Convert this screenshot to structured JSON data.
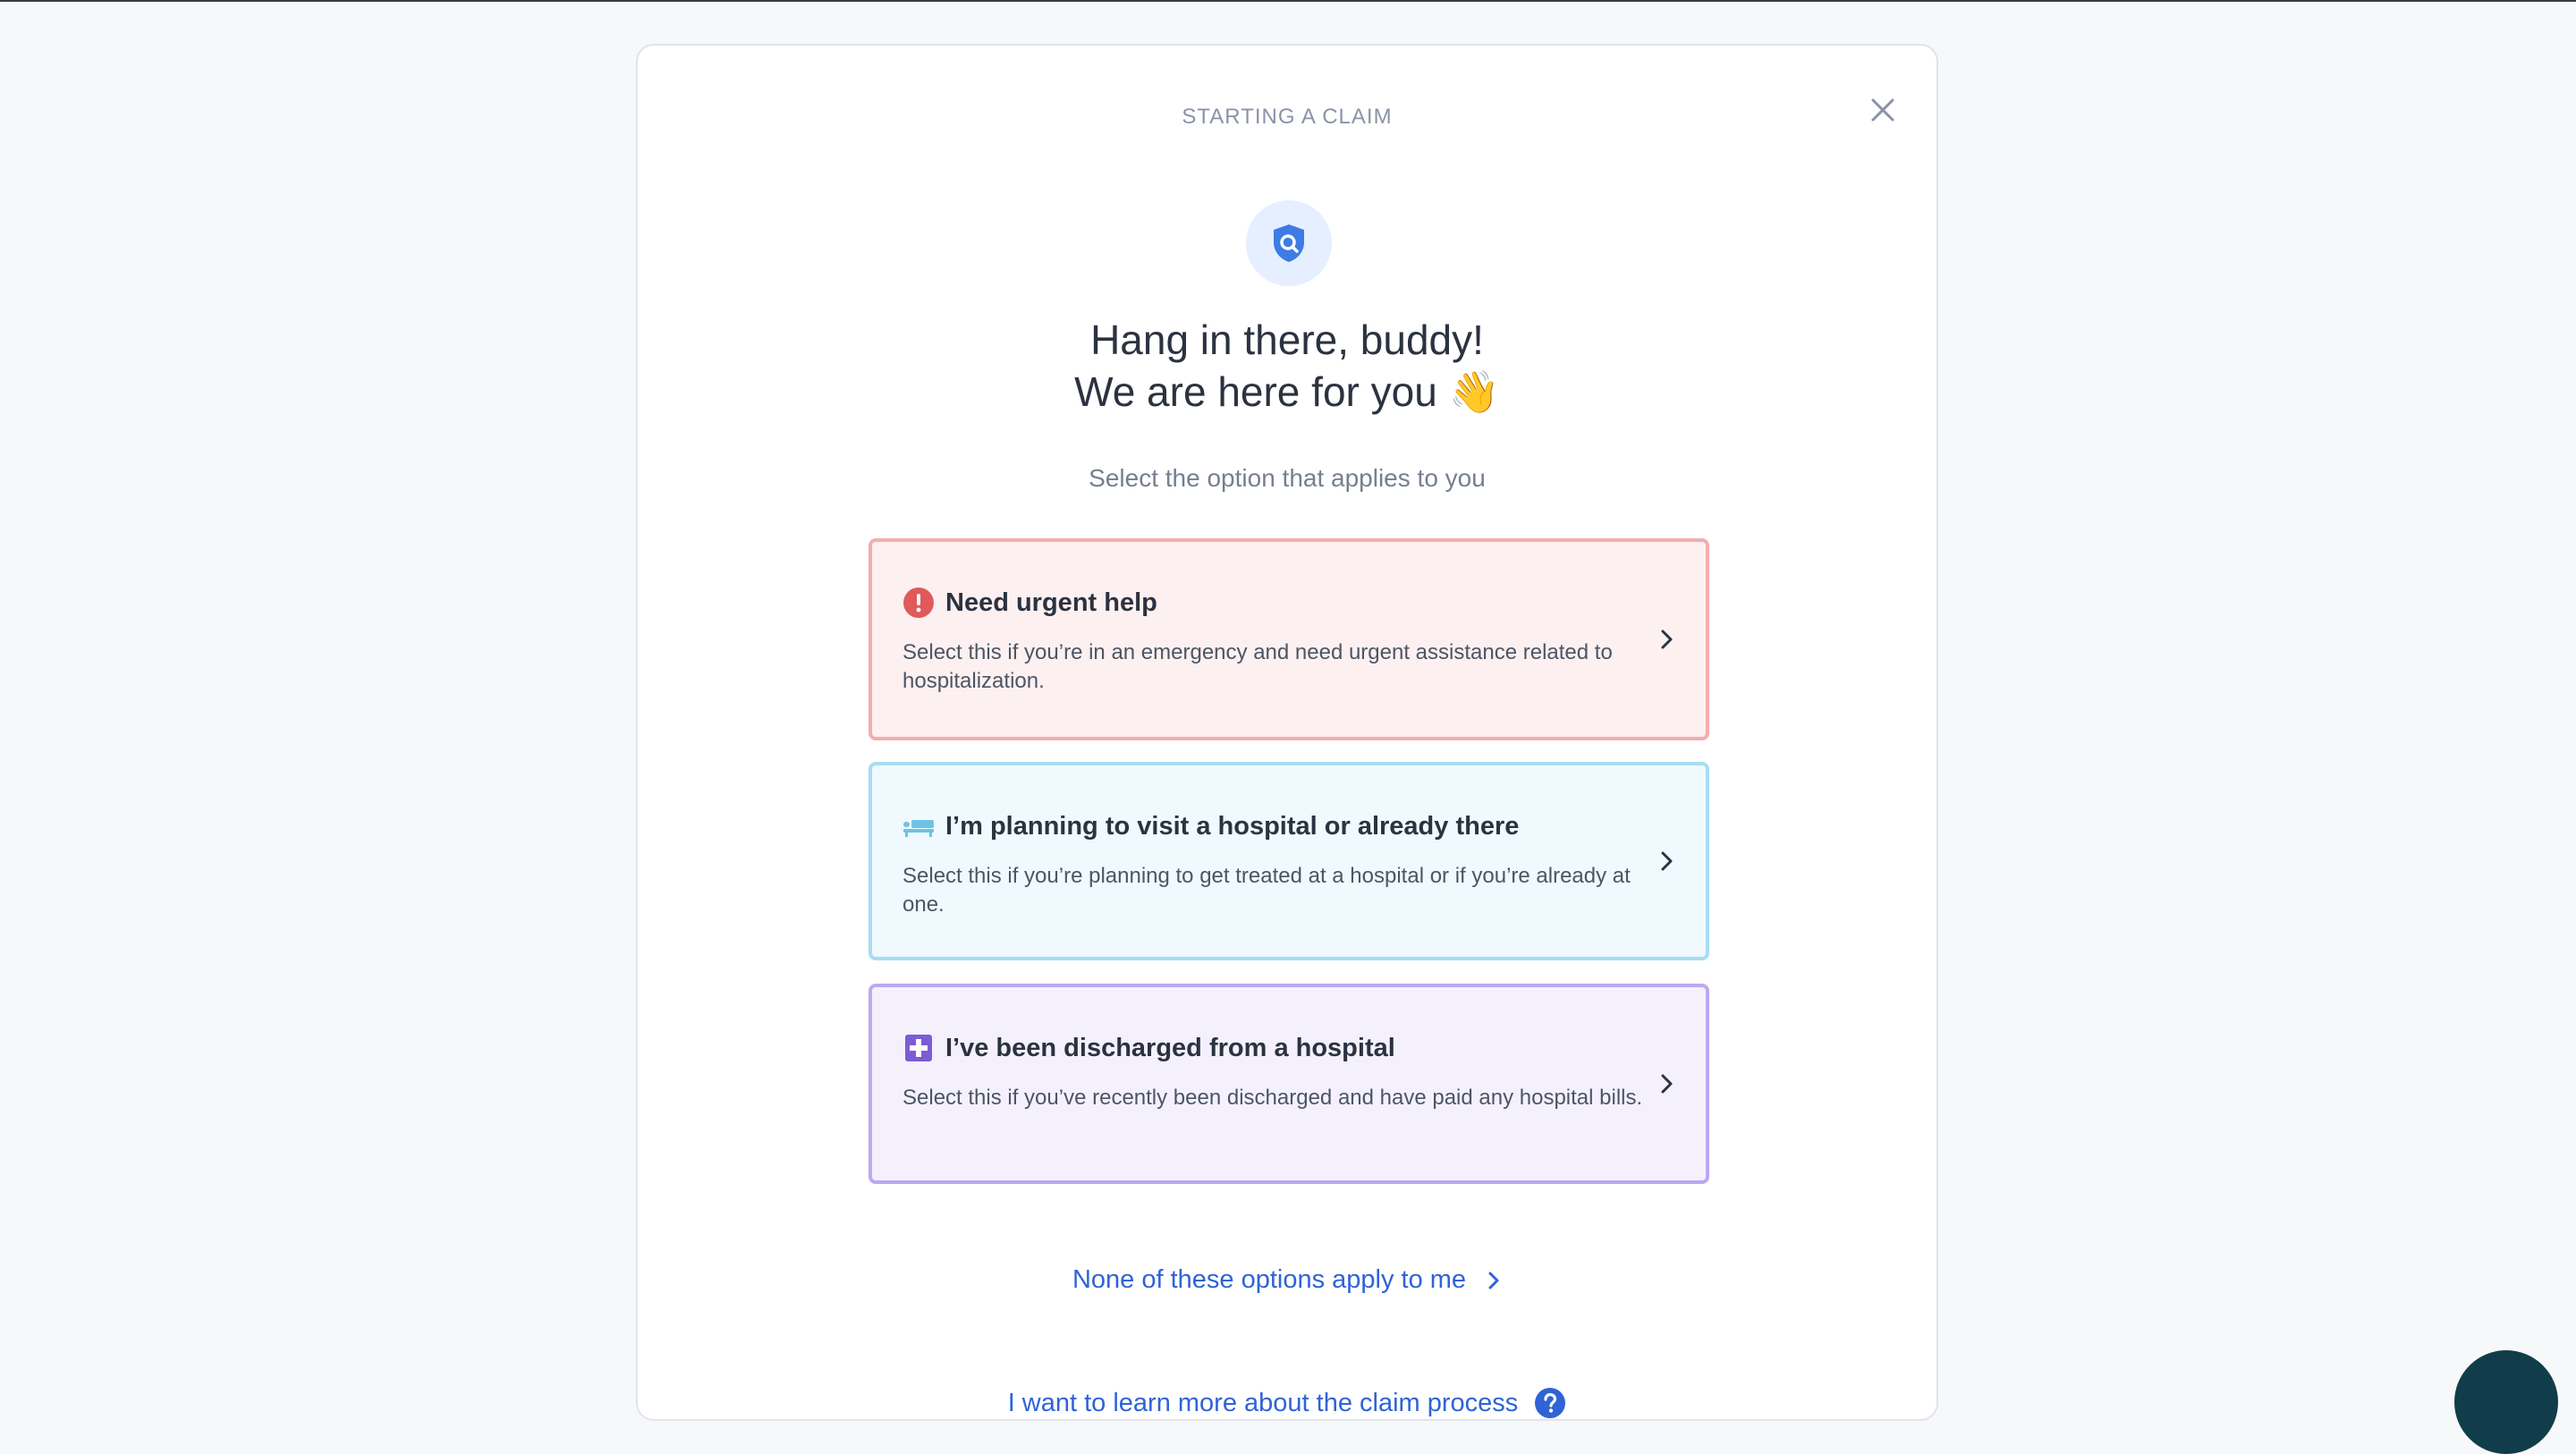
{
  "modal": {
    "kicker": "STARTING A CLAIM",
    "close_icon": "close-icon",
    "hero_icon": "shield-search-icon",
    "headline_line1": "Hang in there, buddy!",
    "headline_line2": "We are here for you",
    "headline_emoji": "👋",
    "subtitle": "Select the option that applies to you"
  },
  "options": [
    {
      "icon": "alert-circle-icon",
      "title": "Need urgent help",
      "description": "Select this if you’re in an emergency and need urgent assistance related to hospitalization.",
      "accent": "#e05a5a"
    },
    {
      "icon": "hospital-bed-icon",
      "title": "I’m planning to visit a hospital or already there",
      "description": "Select this if you’re planning to get treated at a hospital or if you’re already at one.",
      "accent": "#6cc3e6"
    },
    {
      "icon": "medical-cross-icon",
      "title": "I’ve been discharged from a hospital",
      "description": "Select this if you’ve recently been discharged and have paid any hospital bills.",
      "accent": "#7b5cd6"
    }
  ],
  "links": {
    "none_apply": "None of these options apply to me",
    "learn_more": "I want to learn more about the claim process"
  },
  "colors": {
    "link": "#2f63d6",
    "heading": "#2b3240",
    "fab": "#113d4a"
  }
}
